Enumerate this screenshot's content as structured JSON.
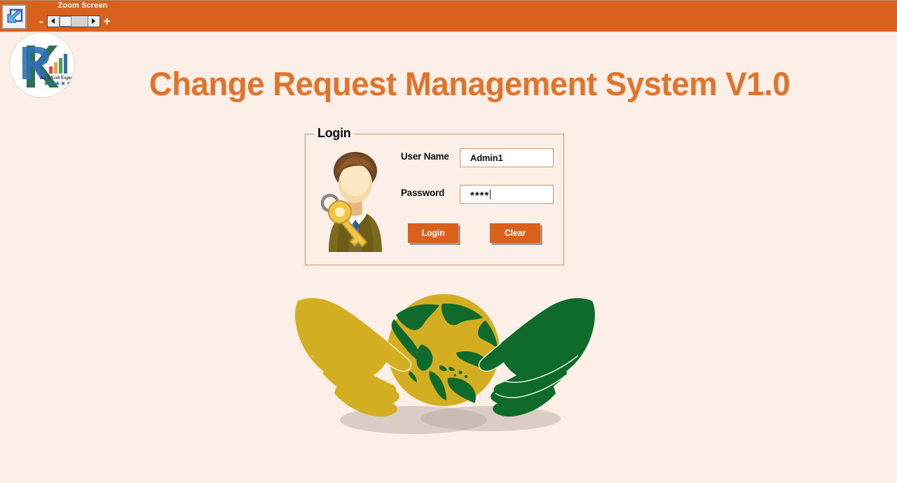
{
  "window": {
    "background_color": "#fcefe7",
    "toolbar_color": "#d9611b"
  },
  "toolbar": {
    "restore_icon": "restore-window-icon",
    "zoom_label": "Zoom Screen",
    "minus_label": "-",
    "plus_label": "+",
    "left_arrow_icon": "scroll-left-arrow-icon",
    "right_arrow_icon": "scroll-right-arrow-icon",
    "thumb_name": "zoom-slider-thumb"
  },
  "logo": {
    "name": "rk-excel-expert-logo",
    "letter_r": "R",
    "letter_k": "K",
    "tagline": "An EXcel Expert",
    "stars": "★★★★★"
  },
  "header": {
    "title": "Change Request Management System V1.0",
    "title_color": "#e2732b"
  },
  "login": {
    "legend": "Login",
    "avatar_icon": "user-with-key-icon",
    "username": {
      "label": "User Name",
      "value": "Admin1",
      "placeholder": ""
    },
    "password": {
      "label": "Password",
      "value": "****",
      "placeholder": ""
    },
    "buttons": {
      "login_label": "Login",
      "clear_label": "Clear",
      "color": "#d9611b"
    },
    "border_color": "#c89468"
  },
  "artwork": {
    "name": "hands-holding-globe-illustration",
    "left_hand_color": "#d4ae21",
    "right_hand_color": "#0f6b2b",
    "globe_land_color": "#0f6b2b",
    "globe_water_color": "#d4ae21"
  }
}
